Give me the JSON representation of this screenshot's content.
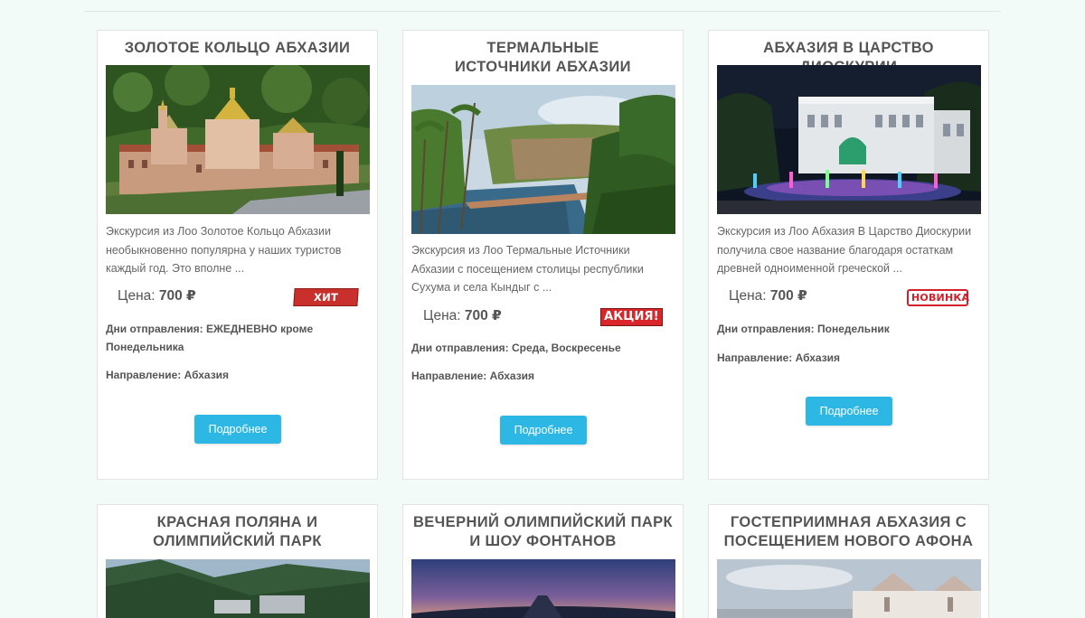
{
  "tours": [
    {
      "title": "Золотое кольцо Абхазии",
      "description": "Экскурсия из Лоо Золотое Кольцо Абхазии необыкновенно популярна у наших туристов каждый год. Это вполне ...",
      "price_label": "Цена:",
      "price_value": "700 ₽",
      "badge": "ХИТ ПРОДАЖ",
      "departure_label": "Дни отправления:",
      "departure_value": "ЕЖЕДНЕВНО кроме Понедельника",
      "direction_label": "Направление:",
      "direction_value": "Абхазия",
      "button_label": "Подробнее"
    },
    {
      "title": "Термальные источники Абхазии",
      "description": "Экскурсия из Лоо Термальные Источники Абхазии с посещением столицы республики Сухума и села Кындыг с ...",
      "price_label": "Цена:",
      "price_value": "700 ₽",
      "badge": "АКЦИЯ!",
      "departure_label": "Дни отправления:",
      "departure_value": "Среда, Воскресенье",
      "direction_label": "Направление:",
      "direction_value": "Абхазия",
      "button_label": "Подробнее"
    },
    {
      "title": "Абхазия в Царство Диоскурии",
      "description": "Экскурсия из Лоо Абхазия В Царство Диоскурии получила свое название благодаря остаткам древней одноименной греческой ...",
      "price_label": "Цена:",
      "price_value": "700 ₽",
      "badge": "НОВИНКА",
      "departure_label": "Дни отправления:",
      "departure_value": "Понедельник",
      "direction_label": "Направление:",
      "direction_value": "Абхазия",
      "button_label": "Подробнее"
    },
    {
      "title": "Красная поляна и Олимпийский парк"
    },
    {
      "title": "Вечерний Олимпийский парк и шоу фонтанов"
    },
    {
      "title": "Гостеприимная Абхазия с посещением Нового Афона"
    }
  ],
  "colors": {
    "page_background": "#f3fbf8",
    "button": "#2db7e5",
    "badge_red": "#d4202a"
  }
}
